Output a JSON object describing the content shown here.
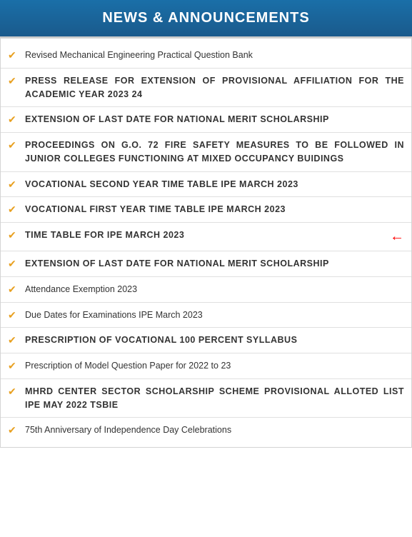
{
  "header": {
    "title": "NEWS & ANNOUNCEMENTS"
  },
  "news_items": [
    {
      "id": 1,
      "text": "Revised Mechanical Engineering Practical Question Bank",
      "uppercase": false,
      "arrow": false
    },
    {
      "id": 2,
      "text": "PRESS RELEASE FOR EXTENSION OF PROVISIONAL AFFILIATION FOR THE ACADEMIC YEAR 2023 24",
      "uppercase": true,
      "arrow": false
    },
    {
      "id": 3,
      "text": "EXTENSION OF LAST DATE FOR NATIONAL MERIT SCHOLARSHIP",
      "uppercase": true,
      "arrow": false
    },
    {
      "id": 4,
      "text": "PROCEEDINGS ON G.O. 72 FIRE SAFETY MEASURES TO BE FOLLOWED IN JUNIOR COLLEGES FUNCTIONING AT MIXED OCCUPANCY BUIDINGS",
      "uppercase": true,
      "arrow": false
    },
    {
      "id": 5,
      "text": "VOCATIONAL SECOND YEAR TIME TABLE IPE MARCH 2023",
      "uppercase": true,
      "arrow": false
    },
    {
      "id": 6,
      "text": "VOCATIONAL FIRST YEAR TIME TABLE IPE MARCH 2023",
      "uppercase": true,
      "arrow": false
    },
    {
      "id": 7,
      "text": "TIME TABLE FOR IPE MARCH 2023",
      "uppercase": true,
      "arrow": true
    },
    {
      "id": 8,
      "text": "EXTENSION OF LAST DATE FOR NATIONAL MERIT SCHOLARSHIP",
      "uppercase": true,
      "arrow": false
    },
    {
      "id": 9,
      "text": "Attendance Exemption 2023",
      "uppercase": false,
      "arrow": false
    },
    {
      "id": 10,
      "text": "Due Dates for Examinations IPE March 2023",
      "uppercase": false,
      "arrow": false
    },
    {
      "id": 11,
      "text": "PRESCRIPTION OF VOCATIONAL 100 PERCENT SYLLABUS",
      "uppercase": true,
      "arrow": false
    },
    {
      "id": 12,
      "text": "Prescription of Model Question Paper for 2022 to 23",
      "uppercase": false,
      "arrow": false
    },
    {
      "id": 13,
      "text": "MHRD CENTER SECTOR SCHOLARSHIP SCHEME PROVISIONAL ALLOTED LIST IPE MAY 2022 TSBIE",
      "uppercase": true,
      "arrow": false
    },
    {
      "id": 14,
      "text": "75th Anniversary of Independence Day Celebrations",
      "uppercase": false,
      "arrow": false
    }
  ],
  "icons": {
    "check": "✔",
    "arrow": "←"
  },
  "colors": {
    "header_bg": "#1a6fa8",
    "header_text": "#ffffff",
    "check_color": "#e8a020",
    "arrow_color": "#cc0000",
    "text_color": "#333333",
    "border_color": "#d4d4d4"
  }
}
